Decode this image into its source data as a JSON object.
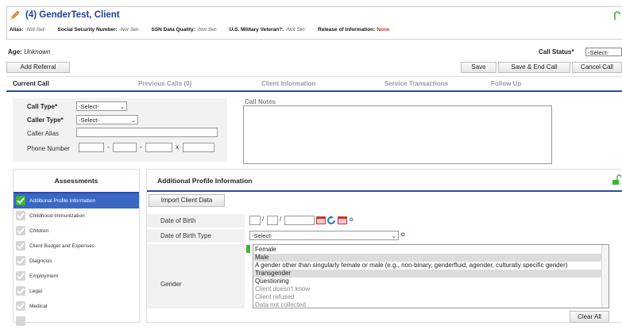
{
  "header": {
    "title": "(4) GenderTest, Client",
    "fields": [
      {
        "label": "Alias:",
        "value": "-Not Set-"
      },
      {
        "label": "Social Security Number:",
        "value": "-Not Set-"
      },
      {
        "label": "SSN Data Quality:",
        "value": "-Not Set-"
      },
      {
        "label": "U.S. Military Veteran?:",
        "value": "-Not Set-"
      },
      {
        "label": "Release of Information:",
        "value": "None"
      }
    ]
  },
  "age": {
    "label": "Age:",
    "value": "Unknown"
  },
  "call_status": {
    "label": "Call Status",
    "req": "*",
    "value": "-Select-"
  },
  "buttons": {
    "add_referral": "Add Referral",
    "save": "Save",
    "save_end": "Save & End Call",
    "cancel": "Cancel Call",
    "import": "Import Client Data",
    "clear_all": "Clear All"
  },
  "tabs": [
    {
      "label": "Current Call",
      "active": true
    },
    {
      "label": "Previous Calls (0)"
    },
    {
      "label": "Client Information"
    },
    {
      "label": "Service Transactions"
    },
    {
      "label": "Follow Up"
    }
  ],
  "form": {
    "call_type": {
      "label": "Call Type",
      "req": "*",
      "value": "-Select-"
    },
    "caller_type": {
      "label": "Caller Type",
      "req": "*",
      "value": "-Select-"
    },
    "caller_alias": {
      "label": "Caller Alias",
      "value": ""
    },
    "phone": {
      "label": "Phone Number",
      "sep1": "-",
      "sep2": "-",
      "sep3": "x"
    },
    "call_notes": {
      "label": "Call Notes",
      "value": ""
    }
  },
  "assessments": {
    "title": "Assessments",
    "items": [
      "Additional Profile Information",
      "Childhood Immunization",
      "Children",
      "Client Budget and Expenses",
      "Diagnosis",
      "Employment",
      "Legal",
      "Medical",
      ""
    ],
    "active_index": 0
  },
  "profile": {
    "title": "Additional Profile Information",
    "dob": {
      "label": "Date of Birth",
      "sep": "/",
      "g": "G"
    },
    "dob_type": {
      "label": "Date of Birth Type",
      "value": "-Select-",
      "g": "G"
    },
    "gender": {
      "label": "Gender",
      "options": [
        {
          "text": "Female",
          "selected": false,
          "grey": false
        },
        {
          "text": "Male",
          "selected": true,
          "grey": false
        },
        {
          "text": "A gender other than singularly female or male (e.g., non-binary, genderfluid, agender, culturally specific gender)",
          "selected": false,
          "grey": false
        },
        {
          "text": "Transgender",
          "selected": true,
          "grey": false
        },
        {
          "text": "Questioning",
          "selected": false,
          "grey": false
        },
        {
          "text": "Client doesn't know",
          "selected": false,
          "grey": true
        },
        {
          "text": "Client refused",
          "selected": false,
          "grey": true
        },
        {
          "text": "Data not collected",
          "selected": false,
          "grey": true
        }
      ]
    }
  },
  "colors": {
    "accent": "#2c4aa8",
    "active_item": "#3a66c4",
    "check_green": "#3cb43c",
    "alert_red": "#c0392b"
  }
}
